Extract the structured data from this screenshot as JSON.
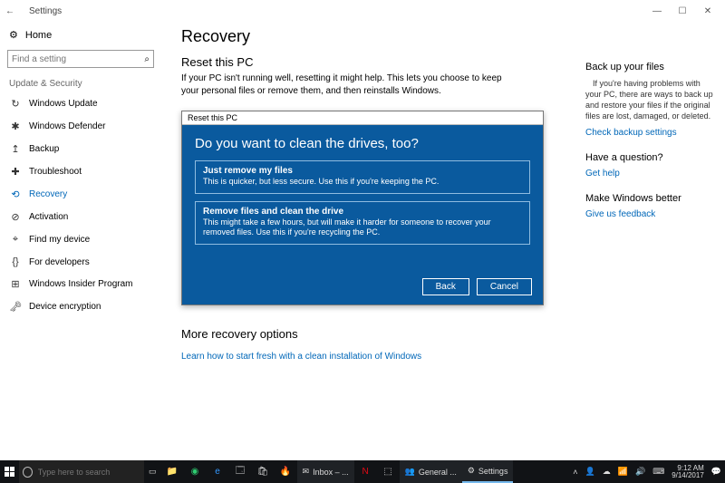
{
  "window": {
    "title": "Settings"
  },
  "sidebar": {
    "home": "Home",
    "search_placeholder": "Find a setting",
    "group": "Update & Security",
    "items": [
      {
        "label": "Windows Update",
        "icon": "↻"
      },
      {
        "label": "Windows Defender",
        "icon": "✱"
      },
      {
        "label": "Backup",
        "icon": "↥"
      },
      {
        "label": "Troubleshoot",
        "icon": "✚"
      },
      {
        "label": "Recovery",
        "icon": "⟲",
        "selected": true
      },
      {
        "label": "Activation",
        "icon": "⊘"
      },
      {
        "label": "Find my device",
        "icon": "⌖"
      },
      {
        "label": "For developers",
        "icon": "{}"
      },
      {
        "label": "Windows Insider Program",
        "icon": "⊞"
      },
      {
        "label": "Device encryption",
        "icon": "🗝"
      }
    ]
  },
  "main": {
    "heading": "Recovery",
    "section_title": "Reset this PC",
    "section_desc": "If your PC isn't running well, resetting it might help. This lets you choose to keep your personal files or remove them, and then reinstalls Windows.",
    "more_heading": "More recovery options",
    "more_link": "Learn how to start fresh with a clean installation of Windows"
  },
  "dialog": {
    "title": "Reset this PC",
    "question": "Do you want to clean the drives, too?",
    "options": [
      {
        "title": "Just remove my files",
        "desc": "This is quicker, but less secure. Use this if you're keeping the PC."
      },
      {
        "title": "Remove files and clean the drive",
        "desc": "This might take a few hours, but will make it harder for someone to recover your removed files. Use this if you're recycling the PC."
      }
    ],
    "back": "Back",
    "cancel": "Cancel"
  },
  "right": {
    "backup_h": "Back up your files",
    "backup_p": "If you're having problems with your PC, there are ways to back up and restore your files if the original files are lost, damaged, or deleted.",
    "backup_link": "Check backup settings",
    "question_h": "Have a question?",
    "question_link": "Get help",
    "better_h": "Make Windows better",
    "better_link": "Give us feedback"
  },
  "taskbar": {
    "search_placeholder": "Type here to search",
    "apps": [
      {
        "label": "Inbox – ...",
        "icon": "✉"
      },
      {
        "label": "General ...",
        "icon": "👥"
      },
      {
        "label": "Settings",
        "icon": "⚙"
      }
    ],
    "time": "9:12 AM",
    "date": "9/14/2017"
  }
}
